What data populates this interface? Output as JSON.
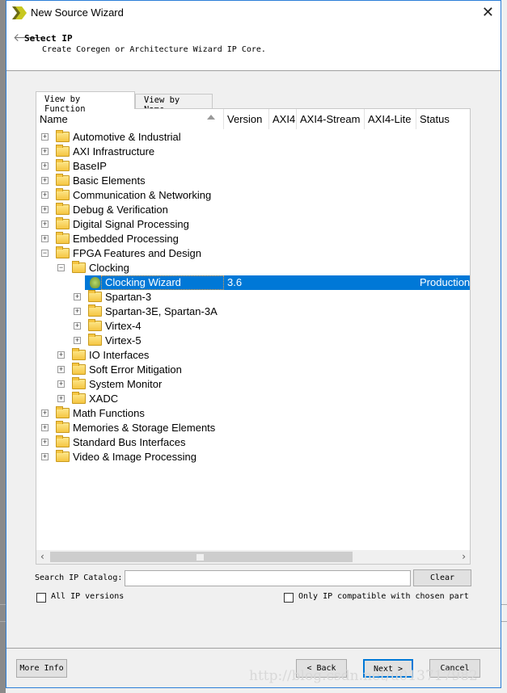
{
  "window": {
    "title": "New Source Wizard",
    "close_icon": "close-icon"
  },
  "header": {
    "title": "Select IP",
    "subtitle": "Create Coregen or Architecture Wizard IP Core."
  },
  "tabs": [
    {
      "label": "View by Function",
      "active": true
    },
    {
      "label": "View by Name",
      "active": false
    }
  ],
  "columns": [
    "Name",
    "Version",
    "AXI4",
    "AXI4-Stream",
    "AXI4-Lite",
    "Status"
  ],
  "tree": [
    {
      "label": "Automotive & Industrial",
      "level": 0,
      "expander": "+"
    },
    {
      "label": "AXI Infrastructure",
      "level": 0,
      "expander": "+"
    },
    {
      "label": "BaseIP",
      "level": 0,
      "expander": "+"
    },
    {
      "label": "Basic Elements",
      "level": 0,
      "expander": "+"
    },
    {
      "label": "Communication & Networking",
      "level": 0,
      "expander": "+"
    },
    {
      "label": "Debug & Verification",
      "level": 0,
      "expander": "+"
    },
    {
      "label": "Digital Signal Processing",
      "level": 0,
      "expander": "+"
    },
    {
      "label": "Embedded Processing",
      "level": 0,
      "expander": "+"
    },
    {
      "label": "FPGA Features and Design",
      "level": 0,
      "expander": "-"
    },
    {
      "label": "Clocking",
      "level": 1,
      "expander": "-"
    },
    {
      "label": "Clocking Wizard",
      "level": 2,
      "leaf": true,
      "selected": true,
      "version": "3.6",
      "status": "Production"
    },
    {
      "label": "Spartan-3",
      "level": 2,
      "expander": "+"
    },
    {
      "label": "Spartan-3E, Spartan-3A",
      "level": 2,
      "expander": "+"
    },
    {
      "label": "Virtex-4",
      "level": 2,
      "expander": "+"
    },
    {
      "label": "Virtex-5",
      "level": 2,
      "expander": "+"
    },
    {
      "label": "IO Interfaces",
      "level": 1,
      "expander": "+"
    },
    {
      "label": "Soft Error Mitigation",
      "level": 1,
      "expander": "+"
    },
    {
      "label": "System Monitor",
      "level": 1,
      "expander": "+"
    },
    {
      "label": "XADC",
      "level": 1,
      "expander": "+"
    },
    {
      "label": "Math Functions",
      "level": 0,
      "expander": "+"
    },
    {
      "label": "Memories & Storage Elements",
      "level": 0,
      "expander": "+"
    },
    {
      "label": "Standard Bus Interfaces",
      "level": 0,
      "expander": "+"
    },
    {
      "label": "Video & Image Processing",
      "level": 0,
      "expander": "+"
    }
  ],
  "search": {
    "label": "Search IP Catalog:",
    "value": "",
    "clear_label": "Clear"
  },
  "options": {
    "all_versions": {
      "label": "All IP versions",
      "checked": false
    },
    "compatible": {
      "label": "Only IP compatible with chosen part",
      "checked": false
    }
  },
  "buttons": {
    "more_info": "More Info",
    "back": "< Back",
    "next": "Next >",
    "cancel": "Cancel"
  },
  "watermark": "http://blog.csdn.net/u013717982",
  "colors": {
    "selection": "#0078d7",
    "accent_border": "#2b7fd8"
  }
}
